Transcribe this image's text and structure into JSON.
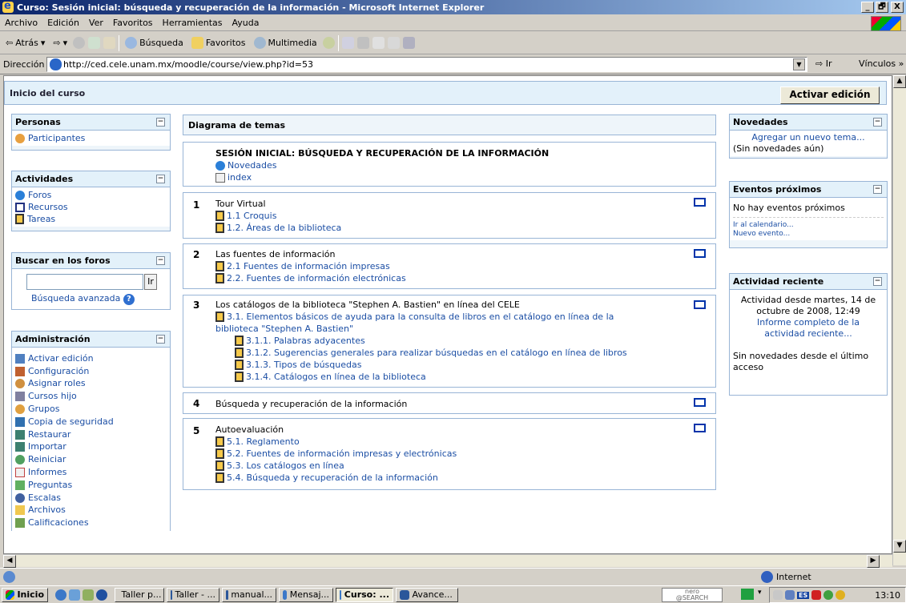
{
  "window": {
    "title": "Curso: Sesión inicial: búsqueda y recuperación de la información - Microsoft Internet Explorer",
    "min": "_",
    "max": "🗗",
    "close": "X"
  },
  "menu": [
    "Archivo",
    "Edición",
    "Ver",
    "Favoritos",
    "Herramientas",
    "Ayuda"
  ],
  "toolbar": {
    "back": "Atrás",
    "search": "Búsqueda",
    "favorites": "Favoritos",
    "media": "Multimedia"
  },
  "address": {
    "label": "Dirección",
    "url": "http://ced.cele.unam.mx/moodle/course/view.php?id=53",
    "go": "Ir",
    "links": "Vínculos"
  },
  "navbar": {
    "home": "Inicio del curso",
    "edit_button": "Activar edición"
  },
  "personas": {
    "title": "Personas",
    "items": [
      "Participantes"
    ]
  },
  "actividades": {
    "title": "Actividades",
    "items": [
      "Foros",
      "Recursos",
      "Tareas"
    ]
  },
  "buscar": {
    "title": "Buscar en los foros",
    "go": "Ir",
    "advanced": "Búsqueda avanzada"
  },
  "admin": {
    "title": "Administración",
    "items": [
      "Activar edición",
      "Configuración",
      "Asignar roles",
      "Cursos hijo",
      "Grupos",
      "Copia de seguridad",
      "Restaurar",
      "Importar",
      "Reiniciar",
      "Informes",
      "Preguntas",
      "Escalas",
      "Archivos",
      "Calificaciones"
    ]
  },
  "topics": {
    "header": "Diagrama de temas",
    "intro": {
      "title": "SESIÓN INICIAL: BÚSQUEDA Y RECUPERACIÓN DE LA INFORMACIÓN",
      "items": [
        "Novedades",
        "index"
      ]
    },
    "t1": {
      "num": "1",
      "title": "Tour Virtual",
      "items": [
        "1.1 Croquis",
        "1.2. Áreas de la biblioteca"
      ]
    },
    "t2": {
      "num": "2",
      "title": "Las fuentes de información",
      "items": [
        "2.1 Fuentes de información impresas",
        "2.2. Fuentes de información electrónicas"
      ]
    },
    "t3": {
      "num": "3",
      "title": "Los catálogos de la biblioteca \"Stephen A. Bastien\" en línea del CELE",
      "item_main_1": "3.1. Elementos básicos de ayuda para la consulta de libros en el catálogo en línea de la",
      "item_main_2": "biblioteca \"Stephen A. Bastien\"",
      "items": [
        "3.1.1. Palabras adyacentes",
        "3.1.2. Sugerencias generales para realizar búsquedas en el catálogo en línea de libros",
        "3.1.3. Tipos de búsquedas",
        "3.1.4. Catálogos en línea de la biblioteca"
      ]
    },
    "t4": {
      "num": "4",
      "title": "Búsqueda y recuperación de la información"
    },
    "t5": {
      "num": "5",
      "title": "Autoevaluación",
      "items": [
        "5.1. Reglamento",
        "5.2. Fuentes de información impresas y electrónicas",
        "5.3. Los catálogos en línea",
        "5.4. Búsqueda y recuperación de la información"
      ]
    }
  },
  "novedades": {
    "title": "Novedades",
    "add": "Agregar un nuevo tema...",
    "none": "(Sin novedades aún)"
  },
  "eventos": {
    "title": "Eventos próximos",
    "none": "No hay eventos próximos",
    "calendar": "Ir al calendario...",
    "new": "Nuevo evento..."
  },
  "reciente": {
    "title": "Actividad reciente",
    "since_1": "Actividad desde martes, 14 de",
    "since_2": "octubre de 2008, 12:49",
    "report_1": "Informe completo de la",
    "report_2": "actividad reciente...",
    "none_1": "Sin novedades desde el último",
    "none_2": "acceso"
  },
  "status": {
    "zone": "Internet"
  },
  "taskbar": {
    "start": "Inicio",
    "tasks": [
      "Taller p...",
      "Taller - ...",
      "manual...",
      "Mensaj...",
      "Curso: ...",
      "Avance..."
    ],
    "nero": "nero",
    "nero_sub": "@SEARCH",
    "lang": "ES",
    "clock": "13:10"
  }
}
